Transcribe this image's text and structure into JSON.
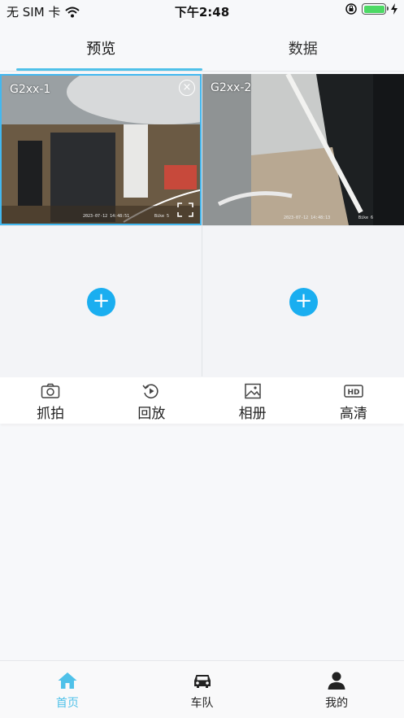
{
  "status": {
    "carrier": "无 SIM 卡",
    "time": "下午2:48"
  },
  "top_tabs": [
    {
      "label": "预览",
      "active": true
    },
    {
      "label": "数据",
      "active": false
    }
  ],
  "videos": [
    {
      "label": "G2xx-1",
      "timestamp": "2023-07-12 14:48:51",
      "overlay": "Bike 5"
    },
    {
      "label": "G2xx-2",
      "timestamp": "2023-07-12 14:48:13",
      "overlay": "Bike 6"
    }
  ],
  "toolbar": [
    {
      "label": "抓拍",
      "icon": "camera-icon"
    },
    {
      "label": "回放",
      "icon": "replay-icon"
    },
    {
      "label": "相册",
      "icon": "album-icon"
    },
    {
      "label": "高清",
      "icon": "hd-icon"
    }
  ],
  "tabbar": [
    {
      "label": "首页",
      "icon": "home-icon",
      "active": true
    },
    {
      "label": "车队",
      "icon": "car-icon",
      "active": false
    },
    {
      "label": "我的",
      "icon": "person-icon",
      "active": false
    }
  ],
  "colors": {
    "accent": "#4fc1e9",
    "add_button": "#1aaef0",
    "battery": "#4cd964"
  }
}
